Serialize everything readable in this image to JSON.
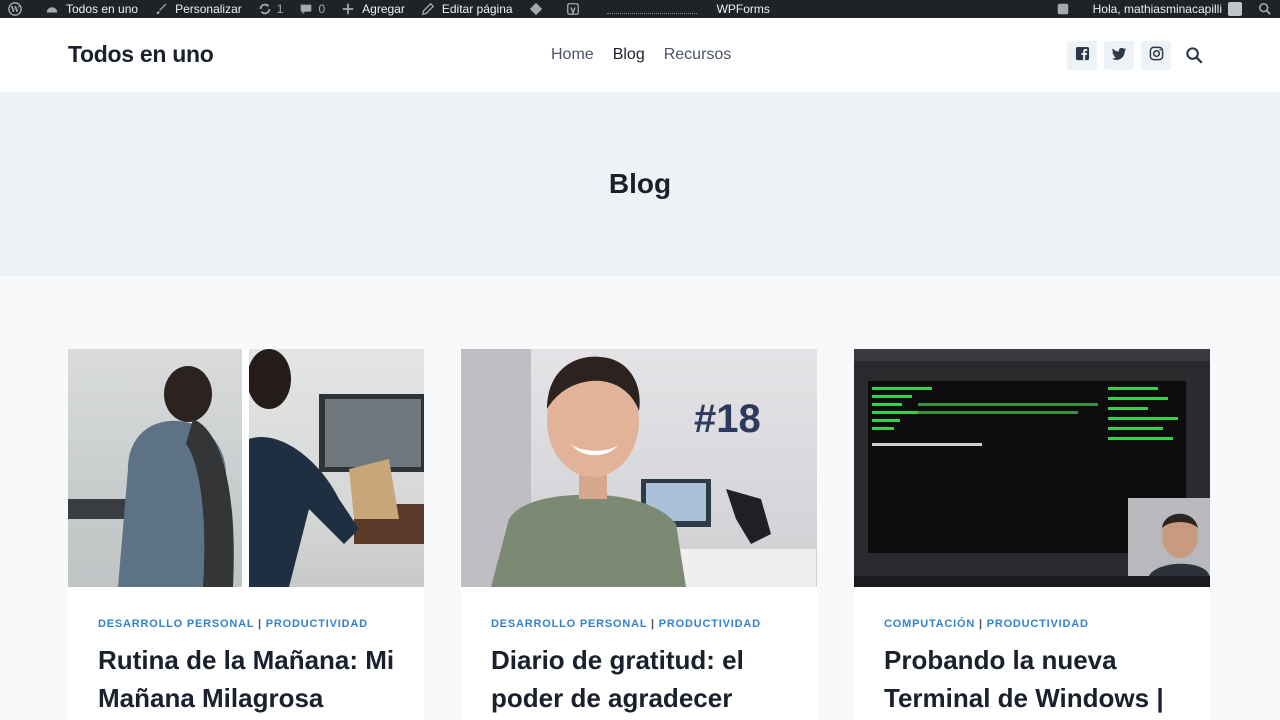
{
  "adminbar": {
    "site_name": "Todos en uno",
    "customize": "Personalizar",
    "updates_count": "1",
    "comments_count": "0",
    "add_new": "Agregar",
    "edit_page": "Editar página",
    "wpforms": "WPForms",
    "greeting": "Hola, mathiasminacapilli"
  },
  "header": {
    "site_title": "Todos en uno",
    "nav": [
      "Home",
      "Blog",
      "Recursos"
    ],
    "active_nav": "Blog"
  },
  "page": {
    "title": "Blog"
  },
  "posts": [
    {
      "categories": [
        "DESARROLLO PERSONAL",
        "PRODUCTIVIDAD"
      ],
      "title": "Rutina de la Mañana: Mi Mañana Milagrosa"
    },
    {
      "categories": [
        "DESARROLLO PERSONAL",
        "PRODUCTIVIDAD"
      ],
      "title": "Diario de gratitud: el poder de agradecer",
      "thumb_text": "#18"
    },
    {
      "categories": [
        "COMPUTACIÓN",
        "PRODUCTIVIDAD"
      ],
      "title": "Probando la nueva Terminal de Windows |"
    }
  ],
  "icons": {
    "social": [
      "facebook-icon",
      "twitter-icon",
      "instagram-icon"
    ],
    "search": "search-icon"
  },
  "colors": {
    "accent": "#3182ce",
    "heading": "#1a202c",
    "adminbar": "#1d2327",
    "hero_bg": "#edf2f7"
  }
}
